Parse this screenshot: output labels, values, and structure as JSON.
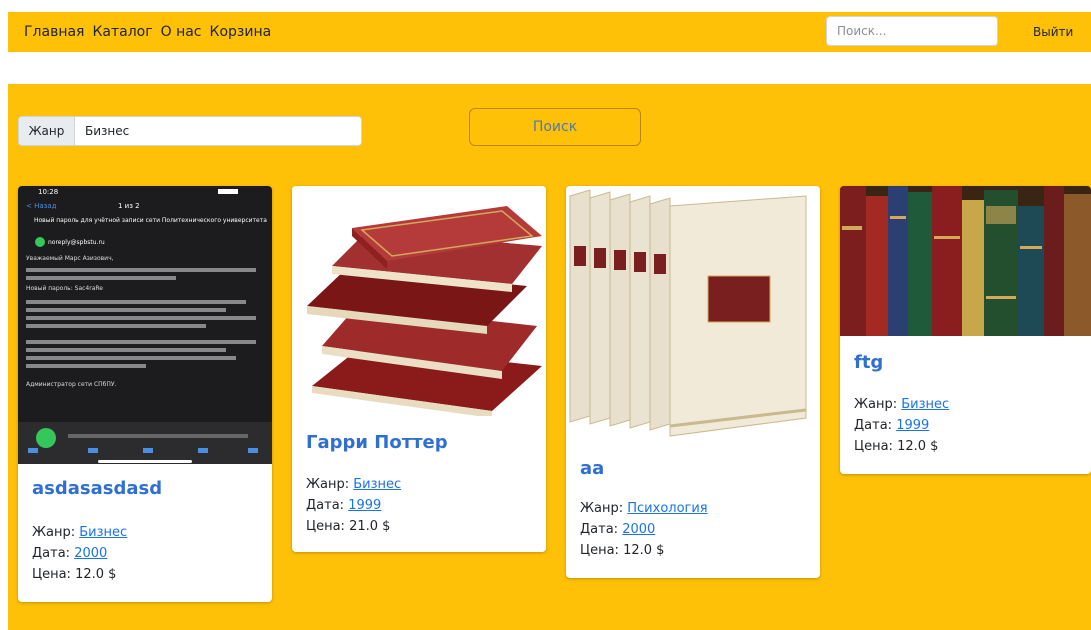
{
  "nav": {
    "links": [
      "Главная",
      "Каталог",
      "О нас",
      "Корзина"
    ],
    "search_placeholder": "Поиск...",
    "logout_label": "Выйти"
  },
  "filter": {
    "label": "Жанр",
    "value": "Бизнес"
  },
  "search_button_label": "Поиск",
  "labels": {
    "genre": "Жанр:",
    "date": "Дата:",
    "price": "Цена:"
  },
  "cards": [
    {
      "title": "asdasasdasd",
      "genre": "Бизнес",
      "date": "2000",
      "price": "12.0 $"
    },
    {
      "title": "Гарри Поттер",
      "genre": "Бизнес",
      "date": "1999",
      "price": "21.0 $"
    },
    {
      "title": "аа",
      "genre": "Психология",
      "date": "2000",
      "price": "12.0 $"
    },
    {
      "title": "ftg",
      "genre": "Бизнес",
      "date": "1999",
      "price": "12.0 $"
    }
  ],
  "phone_screenshot": {
    "time": "10:28",
    "back": "< Назад",
    "counter": "1 из 2",
    "subject": "Новый пароль для учётной записи сети Политехнического университета",
    "sender": "noreply@spbstu.ru",
    "greeting": "Уважаемый Марс Азизович,",
    "password_line": "Новый пароль: Sac4raRe",
    "signature": "Администратор сети СПбПУ."
  },
  "colors": {
    "accent": "#ffc107",
    "title_link": "#2f6fd1",
    "link": "#1a73e8"
  }
}
